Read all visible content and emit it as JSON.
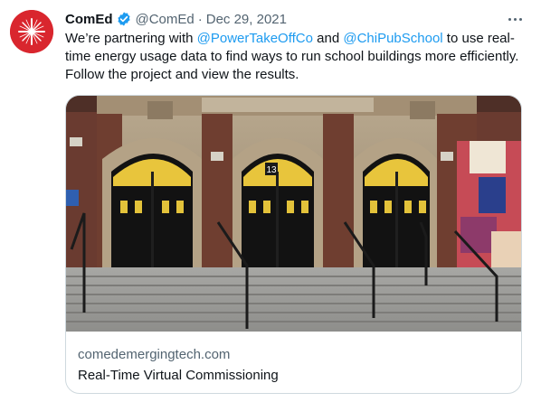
{
  "tweet": {
    "author_name": "ComEd",
    "author_handle": "@ComEd",
    "separator": "·",
    "date": "Dec 29, 2021",
    "text_parts": [
      "We’re partnering with ",
      "@PowerTakeOffCo",
      " and ",
      "@ChiPubSchool",
      " to use real-time energy usage data to find ways to run school buildings more efficiently. Follow the project and view the results."
    ],
    "door_number": "13"
  },
  "card": {
    "domain": "comedemergingtech.com",
    "title": "Real-Time Virtual Commissioning"
  },
  "colors": {
    "brand_red": "#d9262e",
    "link_blue": "#1d9bf0",
    "verified_blue": "#1d9bf0",
    "secondary_text": "#536471"
  },
  "icons": {
    "avatar": "comed-logo-star",
    "verified": "verified-badge-icon",
    "more": "more-horizontal-icon"
  }
}
